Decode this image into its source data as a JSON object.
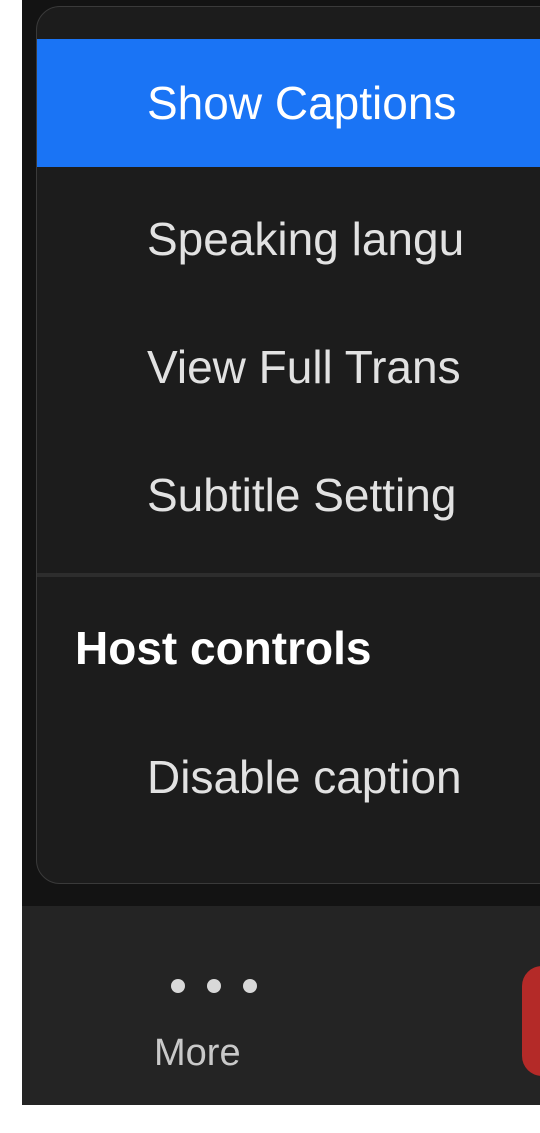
{
  "menu": {
    "items": [
      {
        "label": "Show Captions",
        "selected": true
      },
      {
        "label": "Speaking langu",
        "selected": false
      },
      {
        "label": "View Full Trans",
        "selected": false
      },
      {
        "label": "Subtitle Setting",
        "selected": false
      }
    ],
    "host_section": {
      "title": "Host controls",
      "items": [
        {
          "label": "Disable caption"
        }
      ]
    }
  },
  "toolbar": {
    "more": {
      "label": "More",
      "icon": "more-dots-icon"
    },
    "end_button": {
      "icon": "end-button"
    }
  },
  "colors": {
    "selected_bg": "#1a74f5",
    "panel_bg": "#1c1c1c",
    "toolbar_bg": "#242424",
    "end_red": "#b42a28"
  }
}
